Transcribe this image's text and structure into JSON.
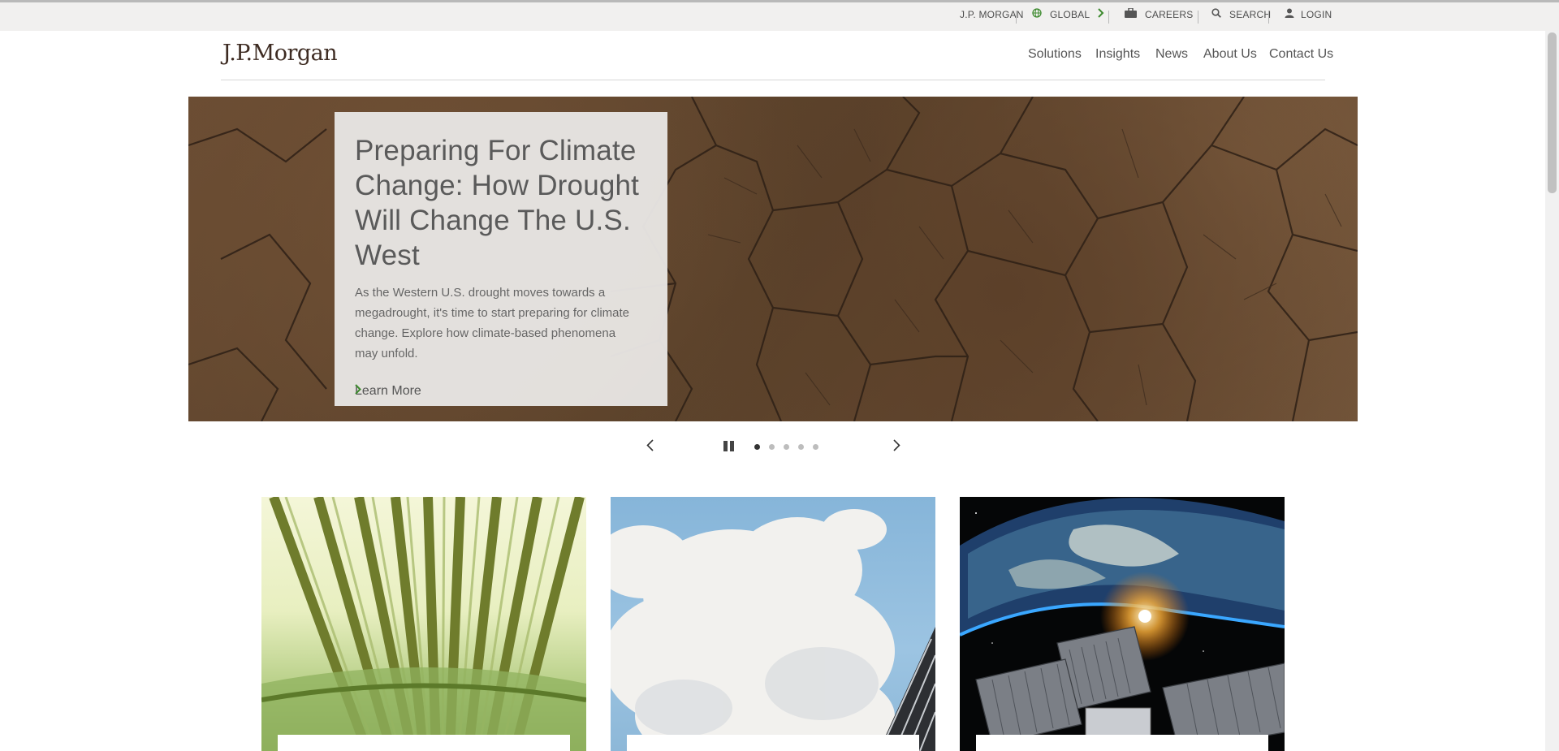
{
  "utility_bar": {
    "brand": "J.P. MORGAN",
    "global": "GLOBAL",
    "careers": "CAREERS",
    "search": "SEARCH",
    "login": "LOGIN"
  },
  "header": {
    "logo": "J.P.Morgan",
    "nav": [
      "Solutions",
      "Insights",
      "News",
      "About Us",
      "Contact Us"
    ]
  },
  "hero": {
    "title": "Preparing For Climate Change: How Drought Will Change The U.S. West",
    "description": "As the Western U.S. drought moves towards a megadrought, it's time to start preparing for climate change. Explore how climate-based phenomena may unfold.",
    "cta": "Learn More",
    "slide_count": 5,
    "active_slide": 1
  },
  "colors": {
    "accent_green": "#3d8a2e",
    "brand_brown": "#3d2b22"
  },
  "icons": {
    "global": "globe-icon",
    "careers": "briefcase-icon",
    "search": "search-icon",
    "login": "user-icon"
  }
}
